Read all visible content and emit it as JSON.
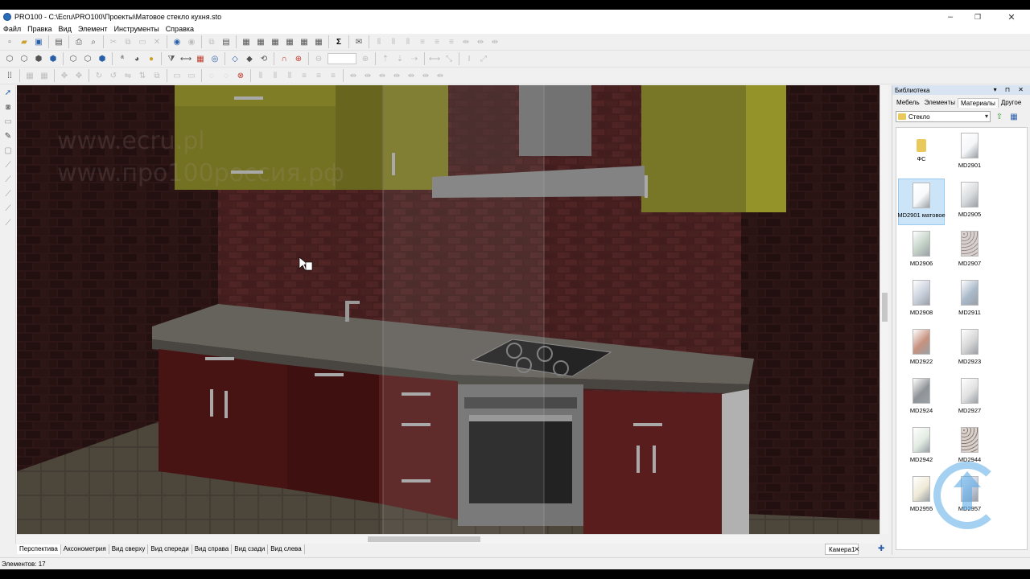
{
  "window": {
    "title": "PRO100 - C:\\Ecru\\PRO100\\Проекты\\Матовое стекло кухня.sto",
    "min": "–",
    "max": "❐",
    "close": "✕"
  },
  "menu": {
    "items": [
      "Файл",
      "Правка",
      "Вид",
      "Элемент",
      "Инструменты",
      "Справка"
    ]
  },
  "viewport": {
    "watermark1": "www.ecru.pl",
    "watermark2": "www.про100россия.рф"
  },
  "view_tabs": [
    "Перспектива",
    "Аксонометрия",
    "Вид сверху",
    "Вид спереди",
    "Вид справа",
    "Вид сзади",
    "Вид слева"
  ],
  "camera_tab": {
    "label": "Камера1",
    "close": "✕",
    "add": "✚"
  },
  "status": {
    "elements": "Элементов: 17"
  },
  "library": {
    "title": "Библиотека",
    "header_icons": "▾ ⊓ ✕",
    "tabs": [
      "Мебель",
      "Элементы",
      "Материалы",
      "Другое"
    ],
    "active_tab": "Материалы",
    "folder": "Стекло",
    "dropdown_arrow": "▾",
    "items": [
      {
        "label": "ФС",
        "kind": "folder",
        "color": "#e9c85c"
      },
      {
        "label": "MD2901",
        "kind": "glass",
        "color": "#f4f6f8"
      },
      {
        "label": "MD2901 матовое",
        "kind": "glass",
        "color": "#f7f9fb",
        "selected": true
      },
      {
        "label": "MD2905",
        "kind": "glass",
        "color": "#d7dadc"
      },
      {
        "label": "MD2906",
        "kind": "glass",
        "color": "#c3d1c6"
      },
      {
        "label": "MD2907",
        "kind": "pattern",
        "color": "#9a8e92"
      },
      {
        "label": "MD2908",
        "kind": "glass",
        "color": "#c9d0dc"
      },
      {
        "label": "MD2911",
        "kind": "glass",
        "color": "#a9b9c9"
      },
      {
        "label": "MD2922",
        "kind": "glass",
        "color": "#c7917d"
      },
      {
        "label": "MD2923",
        "kind": "glass",
        "color": "#d6d6d6"
      },
      {
        "label": "MD2924",
        "kind": "glass",
        "color": "#8f9397"
      },
      {
        "label": "MD2927",
        "kind": "glass",
        "color": "#e1e1e1"
      },
      {
        "label": "MD2942",
        "kind": "glass",
        "color": "#e2ebe2"
      },
      {
        "label": "MD2944",
        "kind": "pattern",
        "color": "#8a7a6e"
      },
      {
        "label": "MD2955",
        "kind": "glass",
        "color": "#efe9d6"
      },
      {
        "label": "MD2957",
        "kind": "glass",
        "color": "#c1c9dd"
      }
    ]
  }
}
